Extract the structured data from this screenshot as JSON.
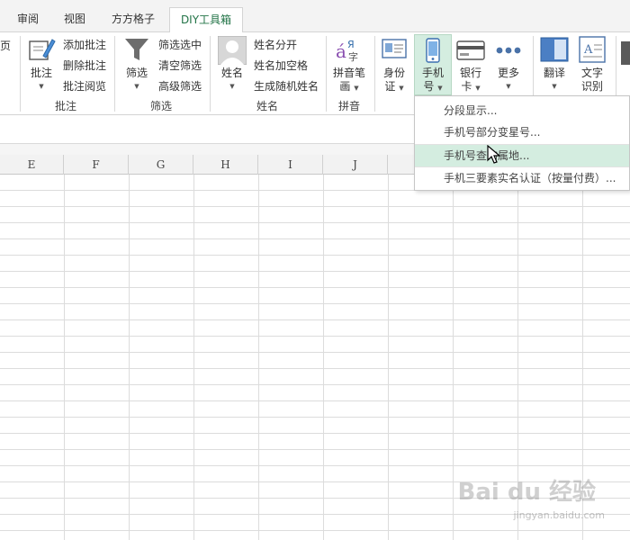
{
  "tabs": [
    "审阅",
    "视图",
    "方方格子",
    "DIY工具箱"
  ],
  "active_tab": "DIY工具箱",
  "ribbon": {
    "page_fragment": "页",
    "annotate": {
      "big_label": "批注",
      "items": [
        "添加批注",
        "删除批注",
        "批注阅览"
      ],
      "group": "批注"
    },
    "filter": {
      "big_label": "筛选",
      "items": [
        "筛选选中",
        "清空筛选",
        "高级筛选"
      ],
      "group": "筛选"
    },
    "name": {
      "big_label": "姓名",
      "items": [
        "姓名分开",
        "姓名加空格",
        "生成随机姓名"
      ],
      "group": "姓名"
    },
    "pinyin": {
      "big_label_1": "拼音笔",
      "big_label_2": "画",
      "group": "拼音"
    },
    "id_card": {
      "label_1": "身份",
      "label_2": "证"
    },
    "phone": {
      "label_1": "手机",
      "label_2": "号"
    },
    "bank": {
      "label_1": "银行",
      "label_2": "卡"
    },
    "more": {
      "label": "更多"
    },
    "translate": {
      "label": "翻译"
    },
    "ocr": {
      "label_1": "文字",
      "label_2": "识别"
    }
  },
  "columns": [
    "E",
    "F",
    "G",
    "H",
    "I",
    "J"
  ],
  "dropdown": {
    "items": [
      "分段显示...",
      "手机号部分变星号...",
      "手机号查询属地...",
      "手机三要素实名认证（按量付费）..."
    ],
    "highlighted_index": 2
  },
  "watermark": {
    "main": "Bai du 经验",
    "sub": "jingyan.baidu.com"
  },
  "colors": {
    "accent": "#217346",
    "highlight": "#d4ede0",
    "phone_btn_bg": "#d4ede0"
  }
}
